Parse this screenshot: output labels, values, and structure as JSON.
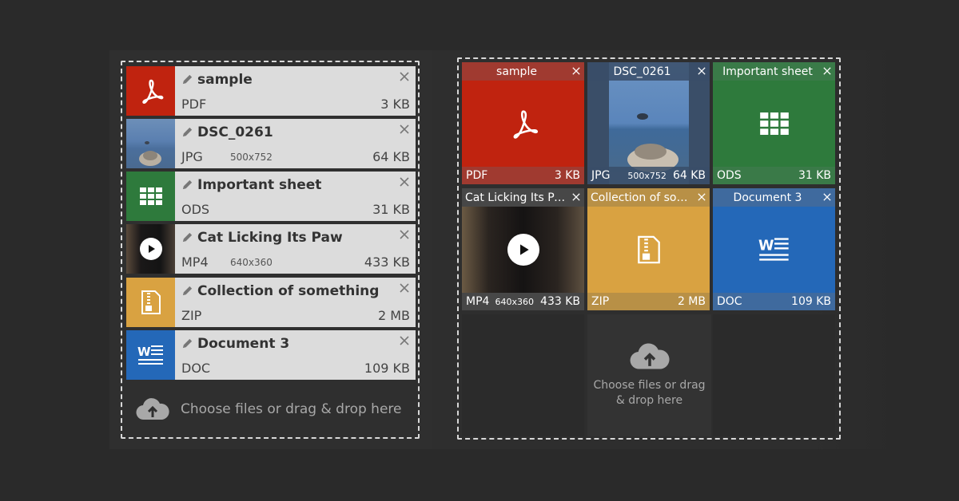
{
  "colors": {
    "pdf": "#c0230f",
    "ods": "#2e7a3c",
    "zip": "#d9a241",
    "doc": "#2468b8",
    "jpg_overlay": "#3a4e68"
  },
  "list": {
    "items": [
      {
        "name": "sample",
        "type": "PDF",
        "dim": "",
        "size": "3 KB",
        "icon": "pdf-icon"
      },
      {
        "name": "DSC_0261",
        "type": "JPG",
        "dim": "500x752",
        "size": "64 KB",
        "icon": "photo-thumbnail"
      },
      {
        "name": "Important sheet",
        "type": "ODS",
        "dim": "",
        "size": "31 KB",
        "icon": "spreadsheet-icon"
      },
      {
        "name": "Cat Licking Its Paw",
        "type": "MP4",
        "dim": "640x360",
        "size": "433 KB",
        "icon": "video-thumbnail"
      },
      {
        "name": "Collection of something",
        "type": "ZIP",
        "dim": "",
        "size": "2 MB",
        "icon": "zip-icon"
      },
      {
        "name": "Document 3",
        "type": "DOC",
        "dim": "",
        "size": "109 KB",
        "icon": "word-icon"
      }
    ],
    "choose_text": "Choose files or drag & drop here"
  },
  "grid": {
    "items": [
      {
        "name": "sample",
        "type": "PDF",
        "dim": "",
        "size": "3 KB"
      },
      {
        "name": "DSC_0261",
        "type": "JPG",
        "dim": "500x752",
        "size": "64 KB"
      },
      {
        "name": "Important sheet",
        "type": "ODS",
        "dim": "",
        "size": "31 KB"
      },
      {
        "name": "Cat Licking Its Paw",
        "type": "MP4",
        "dim": "640x360",
        "size": "433 KB"
      },
      {
        "name": "Collection of som...",
        "type": "ZIP",
        "dim": "",
        "size": "2 MB"
      },
      {
        "name": "Document 3",
        "type": "DOC",
        "dim": "",
        "size": "109 KB"
      }
    ],
    "choose_line1": "Choose files or drag",
    "choose_line2": "& drop here"
  }
}
